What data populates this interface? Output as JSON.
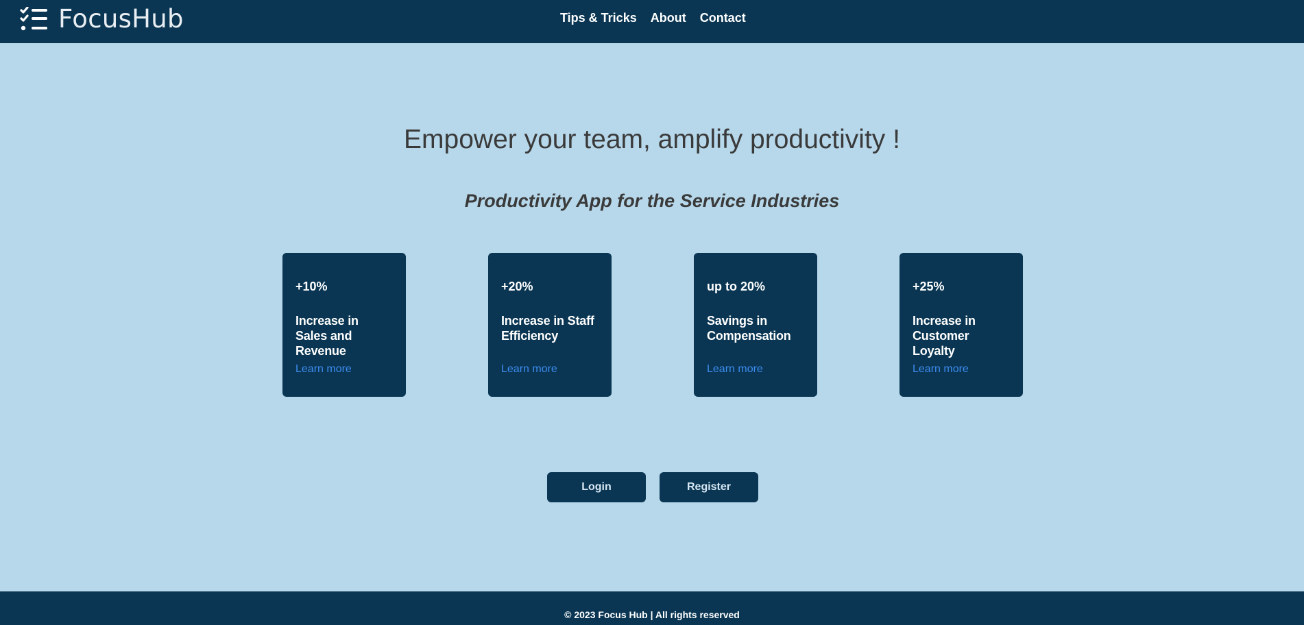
{
  "header": {
    "brand": {
      "name": "FocusHub",
      "icon": "checklist-icon"
    },
    "nav": [
      {
        "label": "Tips & Tricks"
      },
      {
        "label": "About"
      },
      {
        "label": "Contact"
      }
    ]
  },
  "hero": {
    "title": "Empower your team, amplify productivity !",
    "subtitle": "Productivity App for the Service Industries"
  },
  "cards": [
    {
      "stat": "+10%",
      "label": "Increase in Sales and Revenue",
      "link": "Learn more"
    },
    {
      "stat": "+20%",
      "label": "Increase in Staff Efficiency",
      "link": "Learn more"
    },
    {
      "stat": "up to 20%",
      "label": "Savings in Compensation",
      "link": "Learn more"
    },
    {
      "stat": "+25%",
      "label": "Increase in Customer Loyalty",
      "link": "Learn more"
    }
  ],
  "actions": {
    "login_label": "Login",
    "register_label": "Register"
  },
  "footer": {
    "text": "© 2023 Focus Hub | All rights reserved"
  },
  "colors": {
    "primary": "#0a3653",
    "background": "#b7d8eb",
    "link": "#3d8cf0",
    "heading_text": "#3a3a3a"
  }
}
